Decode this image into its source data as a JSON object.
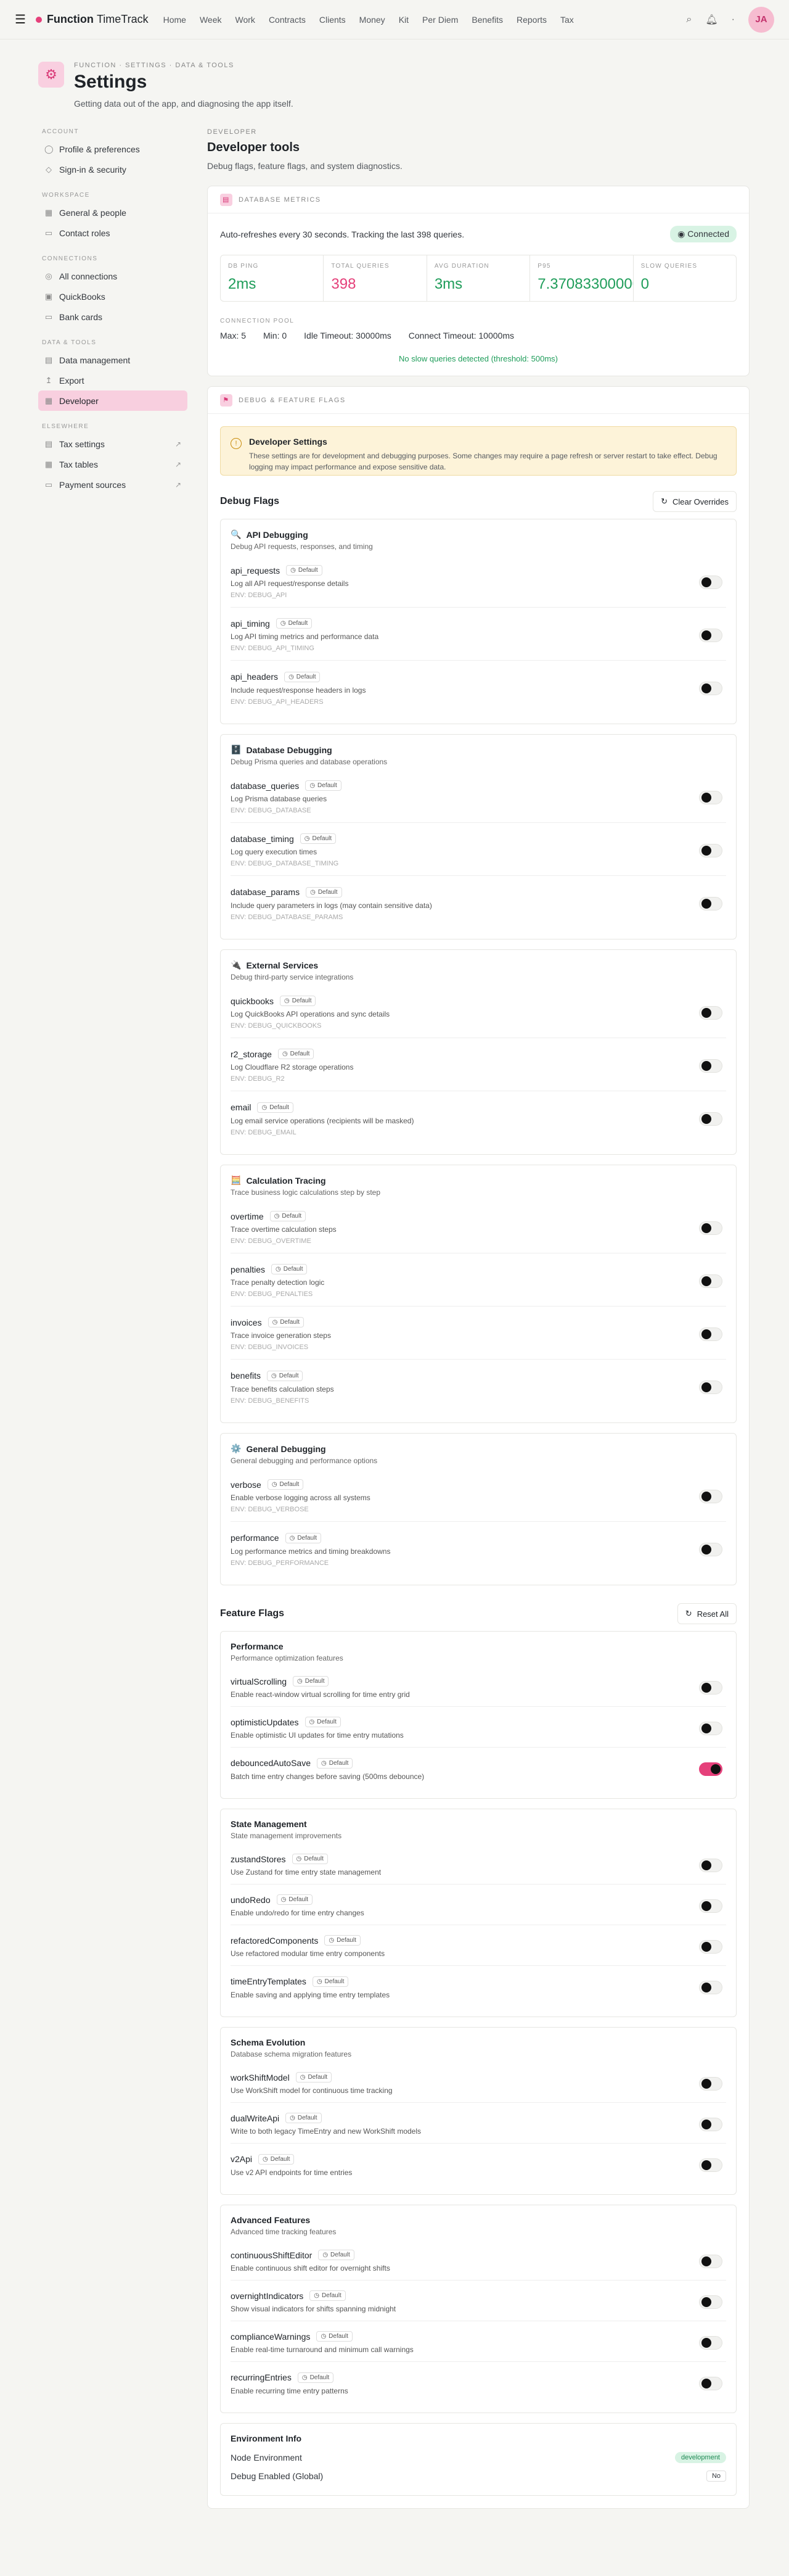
{
  "app": {
    "brand_bold": "Function",
    "brand_light": "TimeTrack",
    "nav": [
      "Home",
      "Week",
      "Work",
      "Contracts",
      "Clients",
      "Money",
      "Kit",
      "Per Diem",
      "Benefits",
      "Reports",
      "Tax"
    ],
    "avatar": "JA"
  },
  "page": {
    "breadcrumb": "FUNCTION · SETTINGS · DATA & TOOLS",
    "title": "Settings",
    "subtitle": "Getting data out of the app, and diagnosing the app itself."
  },
  "sidebar": [
    {
      "label": "Account",
      "items": [
        {
          "label": "Profile & preferences",
          "icon": "user-icon"
        },
        {
          "label": "Sign-in & security",
          "icon": "shield-icon"
        }
      ]
    },
    {
      "label": "Workspace",
      "items": [
        {
          "label": "General & people",
          "icon": "building-icon"
        },
        {
          "label": "Contact roles",
          "icon": "id-icon"
        }
      ]
    },
    {
      "label": "Connections",
      "items": [
        {
          "label": "All connections",
          "icon": "plug-icon"
        },
        {
          "label": "QuickBooks",
          "icon": "qb-icon"
        },
        {
          "label": "Bank cards",
          "icon": "card-icon"
        }
      ]
    },
    {
      "label": "Data & Tools",
      "items": [
        {
          "label": "Data management",
          "icon": "db-icon"
        },
        {
          "label": "Export",
          "icon": "export-icon"
        },
        {
          "label": "Developer",
          "icon": "dev-icon",
          "active": true
        }
      ]
    },
    {
      "label": "Elsewhere",
      "items": [
        {
          "label": "Tax settings",
          "icon": "tax-icon",
          "ext": true
        },
        {
          "label": "Tax tables",
          "icon": "table-icon",
          "ext": true
        },
        {
          "label": "Payment sources",
          "icon": "payment-icon",
          "ext": true
        }
      ]
    }
  ],
  "developer": {
    "label": "DEVELOPER",
    "title": "Developer tools",
    "subtitle": "Debug flags, feature flags, and system diagnostics."
  },
  "db": {
    "head": "DATABASE METRICS",
    "refresh": "Auto-refreshes every 30 seconds. Tracking the last 398 queries.",
    "status": "Connected",
    "metrics": [
      {
        "label": "DB PING",
        "value": "2ms",
        "color": "#1f9d5a"
      },
      {
        "label": "TOTAL QUERIES",
        "value": "398",
        "color": "#e5407a"
      },
      {
        "label": "AVG DURATION",
        "value": "3ms",
        "color": "#1f9d5a"
      },
      {
        "label": "P95",
        "value": "7.370833000000",
        "color": "#1f9d5a"
      },
      {
        "label": "SLOW QUERIES",
        "value": "0",
        "color": "#1f9d5a"
      }
    ],
    "pool_label": "CONNECTION POOL",
    "pool": [
      "Max: 5",
      "Min: 0",
      "Idle Timeout: 30000ms",
      "Connect Timeout: 10000ms"
    ],
    "noslow": "No slow queries detected (threshold: 500ms)"
  },
  "debug": {
    "head": "DEBUG & FEATURE FLAGS",
    "alert_title": "Developer Settings",
    "alert_desc": "These settings are for development and debugging purposes. Some changes may require a page refresh or server restart to take effect. Debug logging may impact performance and expose sensitive data.",
    "flags_title": "Debug Flags",
    "clear": "Clear Overrides",
    "default": "Default",
    "groups": [
      {
        "emoji": "🔍",
        "title": "API Debugging",
        "desc": "Debug API requests, responses, and timing",
        "flags": [
          {
            "name": "api_requests",
            "desc": "Log all API request/response details",
            "env": "ENV: DEBUG_API"
          },
          {
            "name": "api_timing",
            "desc": "Log API timing metrics and performance data",
            "env": "ENV: DEBUG_API_TIMING"
          },
          {
            "name": "api_headers",
            "desc": "Include request/response headers in logs",
            "env": "ENV: DEBUG_API_HEADERS"
          }
        ]
      },
      {
        "emoji": "🗄️",
        "title": "Database Debugging",
        "desc": "Debug Prisma queries and database operations",
        "flags": [
          {
            "name": "database_queries",
            "desc": "Log Prisma database queries",
            "env": "ENV: DEBUG_DATABASE"
          },
          {
            "name": "database_timing",
            "desc": "Log query execution times",
            "env": "ENV: DEBUG_DATABASE_TIMING"
          },
          {
            "name": "database_params",
            "desc": "Include query parameters in logs (may contain sensitive data)",
            "env": "ENV: DEBUG_DATABASE_PARAMS"
          }
        ]
      },
      {
        "emoji": "🔌",
        "title": "External Services",
        "desc": "Debug third-party service integrations",
        "flags": [
          {
            "name": "quickbooks",
            "desc": "Log QuickBooks API operations and sync details",
            "env": "ENV: DEBUG_QUICKBOOKS"
          },
          {
            "name": "r2_storage",
            "desc": "Log Cloudflare R2 storage operations",
            "env": "ENV: DEBUG_R2"
          },
          {
            "name": "email",
            "desc": "Log email service operations (recipients will be masked)",
            "env": "ENV: DEBUG_EMAIL"
          }
        ]
      },
      {
        "emoji": "🧮",
        "title": "Calculation Tracing",
        "desc": "Trace business logic calculations step by step",
        "flags": [
          {
            "name": "overtime",
            "desc": "Trace overtime calculation steps",
            "env": "ENV: DEBUG_OVERTIME"
          },
          {
            "name": "penalties",
            "desc": "Trace penalty detection logic",
            "env": "ENV: DEBUG_PENALTIES"
          },
          {
            "name": "invoices",
            "desc": "Trace invoice generation steps",
            "env": "ENV: DEBUG_INVOICES"
          },
          {
            "name": "benefits",
            "desc": "Trace benefits calculation steps",
            "env": "ENV: DEBUG_BENEFITS"
          }
        ]
      },
      {
        "emoji": "⚙️",
        "title": "General Debugging",
        "desc": "General debugging and performance options",
        "flags": [
          {
            "name": "verbose",
            "desc": "Enable verbose logging across all systems",
            "env": "ENV: DEBUG_VERBOSE"
          },
          {
            "name": "performance",
            "desc": "Log performance metrics and timing breakdowns",
            "env": "ENV: DEBUG_PERFORMANCE"
          }
        ]
      }
    ]
  },
  "features": {
    "title": "Feature Flags",
    "reset": "Reset All",
    "groups": [
      {
        "title": "Performance",
        "desc": "Performance optimization features",
        "flags": [
          {
            "name": "virtualScrolling",
            "desc": "Enable react-window virtual scrolling for time entry grid",
            "on": false
          },
          {
            "name": "optimisticUpdates",
            "desc": "Enable optimistic UI updates for time entry mutations",
            "on": false
          },
          {
            "name": "debouncedAutoSave",
            "desc": "Batch time entry changes before saving (500ms debounce)",
            "on": true
          }
        ]
      },
      {
        "title": "State Management",
        "desc": "State management improvements",
        "flags": [
          {
            "name": "zustandStores",
            "desc": "Use Zustand for time entry state management",
            "on": false
          },
          {
            "name": "undoRedo",
            "desc": "Enable undo/redo for time entry changes",
            "on": false
          },
          {
            "name": "refactoredComponents",
            "desc": "Use refactored modular time entry components",
            "on": false
          },
          {
            "name": "timeEntryTemplates",
            "desc": "Enable saving and applying time entry templates",
            "on": false
          }
        ]
      },
      {
        "title": "Schema Evolution",
        "desc": "Database schema migration features",
        "flags": [
          {
            "name": "workShiftModel",
            "desc": "Use WorkShift model for continuous time tracking",
            "on": false
          },
          {
            "name": "dualWriteApi",
            "desc": "Write to both legacy TimeEntry and new WorkShift models",
            "on": false
          },
          {
            "name": "v2Api",
            "desc": "Use v2 API endpoints for time entries",
            "on": false
          }
        ]
      },
      {
        "title": "Advanced Features",
        "desc": "Advanced time tracking features",
        "flags": [
          {
            "name": "continuousShiftEditor",
            "desc": "Enable continuous shift editor for overnight shifts",
            "on": false
          },
          {
            "name": "overnightIndicators",
            "desc": "Show visual indicators for shifts spanning midnight",
            "on": false
          },
          {
            "name": "complianceWarnings",
            "desc": "Enable real-time turnaround and minimum call warnings",
            "on": false
          },
          {
            "name": "recurringEntries",
            "desc": "Enable recurring time entry patterns",
            "on": false
          }
        ]
      }
    ]
  },
  "env": {
    "title": "Environment Info",
    "node_label": "Node Environment",
    "node_value": "development",
    "debug_label": "Debug Enabled (Global)",
    "debug_value": "No"
  }
}
